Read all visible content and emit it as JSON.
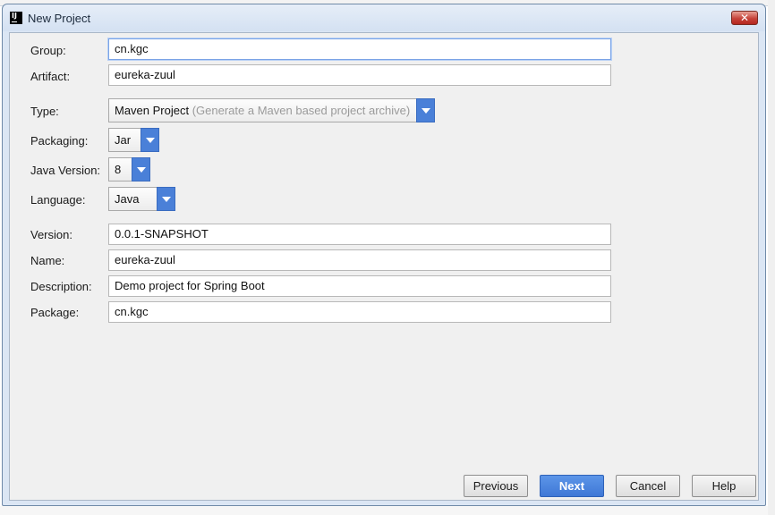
{
  "window": {
    "title": "New Project",
    "icon": "intellij-icon",
    "close_symbol": "✕"
  },
  "form": {
    "group": {
      "label": "Group:",
      "value": "cn.kgc"
    },
    "artifact": {
      "label": "Artifact:",
      "value": "eureka-zuul"
    },
    "type": {
      "label": "Type:",
      "value": "Maven Project",
      "hint": "(Generate a Maven based project archive)"
    },
    "packaging": {
      "label": "Packaging:",
      "value": "Jar"
    },
    "java_version": {
      "label": "Java Version:",
      "value": "8"
    },
    "language": {
      "label": "Language:",
      "value": "Java"
    },
    "version": {
      "label": "Version:",
      "value": "0.0.1-SNAPSHOT"
    },
    "name": {
      "label": "Name:",
      "value": "eureka-zuul"
    },
    "description": {
      "label": "Description:",
      "value": "Demo project for Spring Boot"
    },
    "package": {
      "label": "Package:",
      "value": "cn.kgc"
    }
  },
  "buttons": {
    "previous": "Previous",
    "next": "Next",
    "cancel": "Cancel",
    "help": "Help"
  },
  "colors": {
    "accent": "#4a80d8",
    "primary_button": "#3f78d6",
    "title_bar": "#dbe6f4",
    "close_button": "#c7433a"
  }
}
